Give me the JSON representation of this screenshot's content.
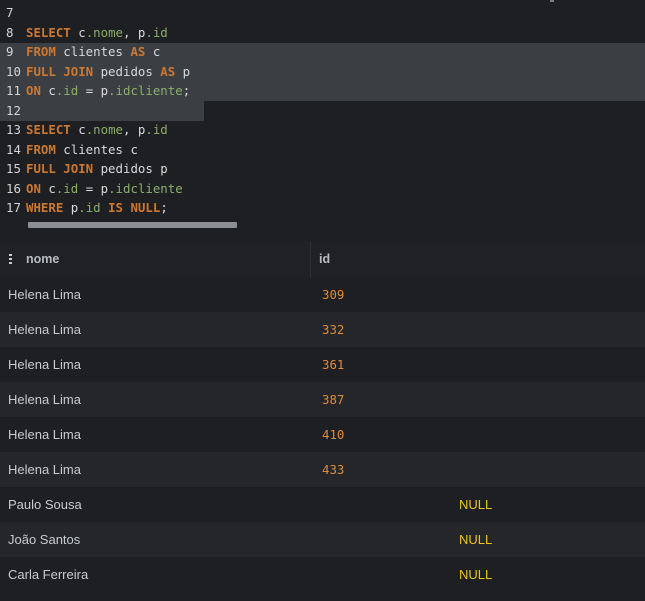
{
  "editor": {
    "lines": [
      {
        "number": "7",
        "tokens": []
      },
      {
        "number": "8",
        "tokens": [
          {
            "t": "SELECT",
            "k": "kw"
          },
          {
            "t": " c",
            "k": "plain"
          },
          {
            "t": ".nome",
            "k": "fld"
          },
          {
            "t": ", p",
            "k": "plain"
          },
          {
            "t": ".id",
            "k": "fld"
          }
        ]
      },
      {
        "number": "9",
        "tokens": [
          {
            "t": "FROM",
            "k": "kw"
          },
          {
            "t": " clientes ",
            "k": "plain"
          },
          {
            "t": "AS",
            "k": "kw"
          },
          {
            "t": " c",
            "k": "plain"
          }
        ]
      },
      {
        "number": "10",
        "tokens": [
          {
            "t": "FULL JOIN",
            "k": "kw"
          },
          {
            "t": " pedidos ",
            "k": "plain"
          },
          {
            "t": "AS",
            "k": "kw"
          },
          {
            "t": " p",
            "k": "plain"
          }
        ]
      },
      {
        "number": "11",
        "tokens": [
          {
            "t": "ON",
            "k": "kw"
          },
          {
            "t": " c",
            "k": "plain"
          },
          {
            "t": ".id",
            "k": "fld"
          },
          {
            "t": " = p",
            "k": "plain"
          },
          {
            "t": ".idcliente",
            "k": "fld"
          },
          {
            "t": ";",
            "k": "plain"
          }
        ]
      },
      {
        "number": "12",
        "tokens": []
      },
      {
        "number": "13",
        "tokens": [
          {
            "t": "SELECT",
            "k": "kw"
          },
          {
            "t": " c",
            "k": "plain"
          },
          {
            "t": ".nome",
            "k": "fld"
          },
          {
            "t": ", p",
            "k": "plain"
          },
          {
            "t": ".id",
            "k": "fld"
          }
        ]
      },
      {
        "number": "14",
        "tokens": [
          {
            "t": "FROM",
            "k": "kw"
          },
          {
            "t": " clientes c",
            "k": "plain"
          }
        ]
      },
      {
        "number": "15",
        "tokens": [
          {
            "t": "FULL JOIN",
            "k": "kw"
          },
          {
            "t": " pedidos p",
            "k": "plain"
          }
        ]
      },
      {
        "number": "16",
        "tokens": [
          {
            "t": "ON",
            "k": "kw"
          },
          {
            "t": " c",
            "k": "plain"
          },
          {
            "t": ".id",
            "k": "fld"
          },
          {
            "t": " = p",
            "k": "plain"
          },
          {
            "t": ".idcliente",
            "k": "fld"
          }
        ]
      },
      {
        "number": "17",
        "tokens": [
          {
            "t": "WHERE",
            "k": "kw"
          },
          {
            "t": " p",
            "k": "plain"
          },
          {
            "t": ".id",
            "k": "fld"
          },
          {
            "t": " ",
            "k": "plain"
          },
          {
            "t": "IS NULL",
            "k": "kw"
          },
          {
            "t": ";",
            "k": "plain"
          }
        ]
      }
    ],
    "selected_lines": [
      "8",
      "9",
      "10",
      "11"
    ]
  },
  "results": {
    "columns": [
      "nome",
      "id"
    ],
    "rows": [
      {
        "nome": "Helena Lima",
        "id": "309"
      },
      {
        "nome": "Helena Lima",
        "id": "332"
      },
      {
        "nome": "Helena Lima",
        "id": "361"
      },
      {
        "nome": "Helena Lima",
        "id": "387"
      },
      {
        "nome": "Helena Lima",
        "id": "410"
      },
      {
        "nome": "Helena Lima",
        "id": "433"
      },
      {
        "nome": "Paulo Sousa",
        "id": "NULL"
      },
      {
        "nome": "João Santos",
        "id": "NULL"
      },
      {
        "nome": "Carla Ferreira",
        "id": "NULL"
      }
    ]
  },
  "colors": {
    "keyword": "#cc7832",
    "field": "#8bae6d",
    "number": "#e08a3a",
    "null": "#e8c51e",
    "selection": "#3b3f44"
  }
}
